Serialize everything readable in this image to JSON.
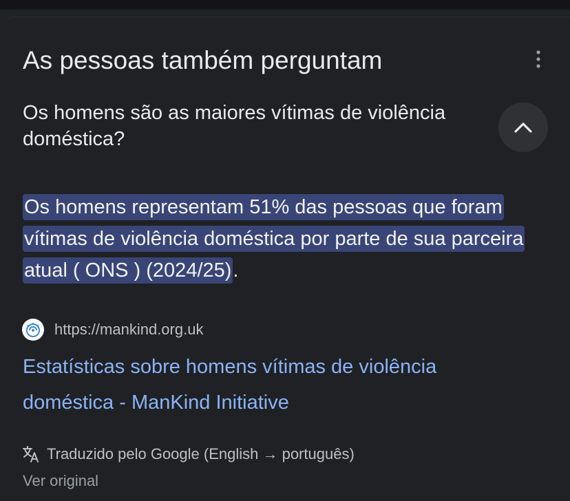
{
  "section": {
    "title": "As pessoas também perguntam",
    "more_icon": "more-vert-icon"
  },
  "question": {
    "text": "Os homens são as maiores vítimas de violência doméstica?",
    "toggle_icon": "chevron-up-icon"
  },
  "answer": {
    "highlighted": "Os homens representam 51% das pessoas que foram vítimas de violência doméstica por parte de sua parceira atual ( ONS ) (2024/25)",
    "trailing": "."
  },
  "source": {
    "favicon": "mankind-logo-icon",
    "url": "https://mankind.org.uk",
    "title": "Estatísticas sobre homens vítimas de violência doméstica - ManKind Initiative"
  },
  "translation": {
    "icon": "translate-icon",
    "label": "Traduzido pelo Google (English → português)",
    "view_original": "Ver original"
  },
  "colors": {
    "background": "#202124",
    "highlight": "#394576",
    "link": "#8ab4f8",
    "text": "#e8eaed",
    "muted": "#bdc1c6"
  }
}
